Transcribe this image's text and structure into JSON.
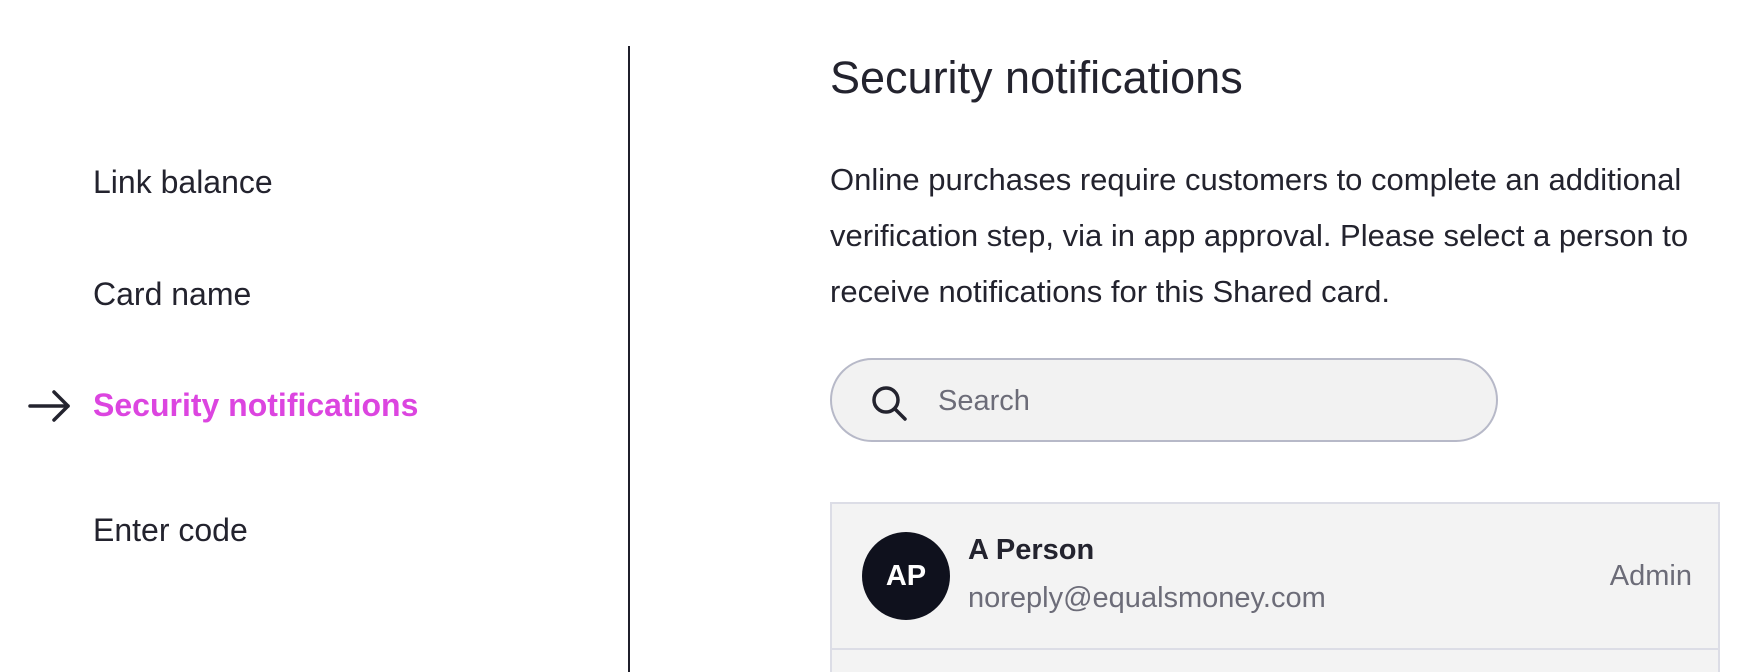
{
  "sidebar": {
    "items": [
      {
        "label": "Link balance",
        "active": false
      },
      {
        "label": "Card name",
        "active": false
      },
      {
        "label": "Security notifications",
        "active": true
      },
      {
        "label": "Enter code",
        "active": false
      }
    ],
    "active_indicator_icon": "arrow-right-icon"
  },
  "main": {
    "title": "Security notifications",
    "description": "Online purchases require customers to complete an additional verification step, via in app approval. Please select a person to receive notifications for this Shared card.",
    "search": {
      "placeholder": "Search",
      "value": "",
      "icon": "search-icon"
    },
    "people": [
      {
        "initials": "AP",
        "name": "A Person",
        "email": "noreply@equalsmoney.com",
        "role": "Admin"
      }
    ]
  },
  "colors": {
    "accent": "#dc45e0",
    "text": "#23232e",
    "muted": "#6c6c78",
    "avatar_bg": "#0f111d",
    "list_bg": "#f3f3f3"
  }
}
